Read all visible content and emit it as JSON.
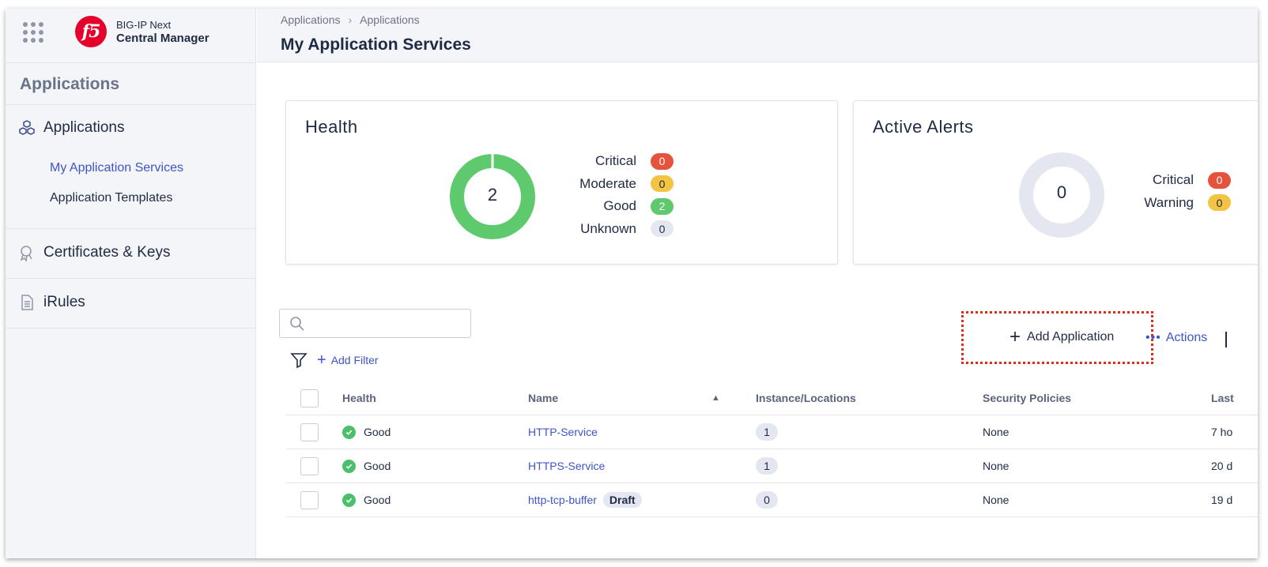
{
  "brand": {
    "logo_text": "f5",
    "product_line1": "BIG-IP Next",
    "product_line2": "Central Manager"
  },
  "sidebar": {
    "heading": "Applications",
    "items": [
      {
        "label": "Applications",
        "icon": "cubes-icon"
      },
      {
        "label": "Certificates & Keys",
        "icon": "certificate-icon"
      },
      {
        "label": "iRules",
        "icon": "document-icon"
      }
    ],
    "sub_items": [
      {
        "label": "My Application Services",
        "active": true
      },
      {
        "label": "Application Templates",
        "active": false
      }
    ]
  },
  "header": {
    "breadcrumb": [
      "Applications",
      "Applications"
    ],
    "title": "My Application Services"
  },
  "health_card": {
    "title": "Health",
    "total": "2",
    "legend": [
      {
        "label": "Critical",
        "value": "0",
        "color": "#e5533d"
      },
      {
        "label": "Moderate",
        "value": "0",
        "color": "#f3c343"
      },
      {
        "label": "Good",
        "value": "2",
        "color": "#5fc96d"
      },
      {
        "label": "Unknown",
        "value": "0",
        "color": "#e4e7f0"
      }
    ]
  },
  "alerts_card": {
    "title": "Active Alerts",
    "total": "0",
    "legend": [
      {
        "label": "Critical",
        "value": "0",
        "color": "#e5533d"
      },
      {
        "label": "Warning",
        "value": "0",
        "color": "#f3c343"
      }
    ]
  },
  "toolbar": {
    "search_placeholder": "",
    "add_filter_label": "Add Filter",
    "add_application_label": "Add Application",
    "actions_label": "Actions"
  },
  "table": {
    "columns": [
      "Health",
      "Name",
      "Instance/Locations",
      "Security Policies",
      "Last"
    ],
    "rows": [
      {
        "health": "Good",
        "name": "HTTP-Service",
        "draft": "",
        "instances": "1",
        "security": "None",
        "last": "7 ho"
      },
      {
        "health": "Good",
        "name": "HTTPS-Service",
        "draft": "",
        "instances": "1",
        "security": "None",
        "last": "20 d"
      },
      {
        "health": "Good",
        "name": "http-tcp-buffer",
        "draft": "Draft",
        "instances": "0",
        "security": "None",
        "last": "19 d"
      }
    ]
  },
  "colors": {
    "accent": "#3e55c7",
    "brand": "#e4002b",
    "highlight": "#e32b1a",
    "good": "#4cbf6a"
  }
}
